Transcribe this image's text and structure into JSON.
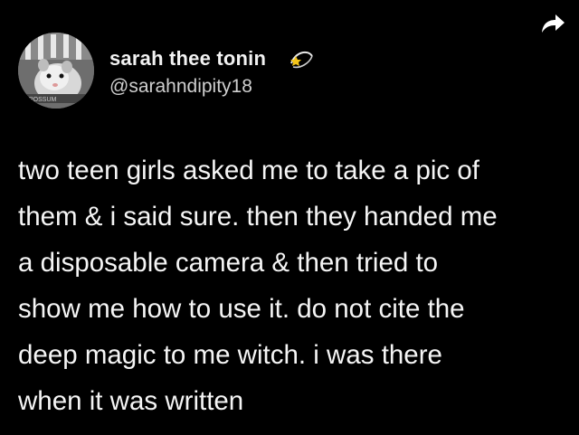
{
  "user": {
    "display_name": "sarah thee tonin",
    "handle": "@sarahndipity18",
    "name_emoji": "dizzy-emoji"
  },
  "tweet": {
    "lines": [
      "two teen girls asked me to take a pic of",
      "them & i said sure. then they handed me",
      "a disposable camera & then tried to",
      "show me how to use it. do not cite the",
      "deep magic to me witch. i was there",
      "when it was written"
    ]
  },
  "actions": {
    "share_icon": "share-arrow-icon"
  },
  "colors": {
    "background": "#000000",
    "text": "#f5f5f5",
    "handle": "#cfcfcf"
  }
}
